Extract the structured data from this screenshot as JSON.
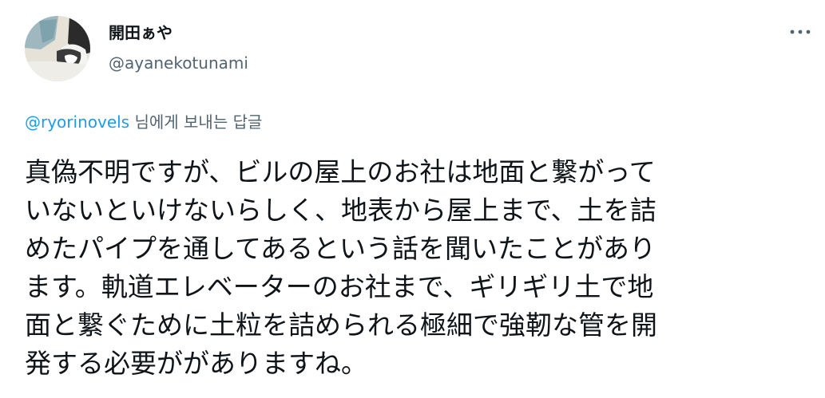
{
  "tweet": {
    "author": {
      "display_name": "開田ぁや",
      "handle": "@ayanekotunami",
      "avatar_icon": "cat-avatar-icon"
    },
    "more_icon": "more-icon",
    "reply_context": {
      "mention": "@ryorinovels",
      "suffix": " 님에게 보내는 답글"
    },
    "text_lines": [
      "真偽不明ですが、ビルの屋上のお社は地面と繋がって",
      "いないといけないらしく、地表から屋上まで、土を詰",
      "めたパイプを通してあるという話を聞いたことがあり",
      "ます。軌道エレベーターのお社まで、ギリギリ土で地",
      "面と繋ぐために土粒を詰められる極細で強靭な管を開",
      "発する必要ががありますね。"
    ]
  },
  "colors": {
    "text_primary": "#0f1419",
    "text_secondary": "#536471",
    "link": "#1d9bf0",
    "background": "#ffffff"
  }
}
